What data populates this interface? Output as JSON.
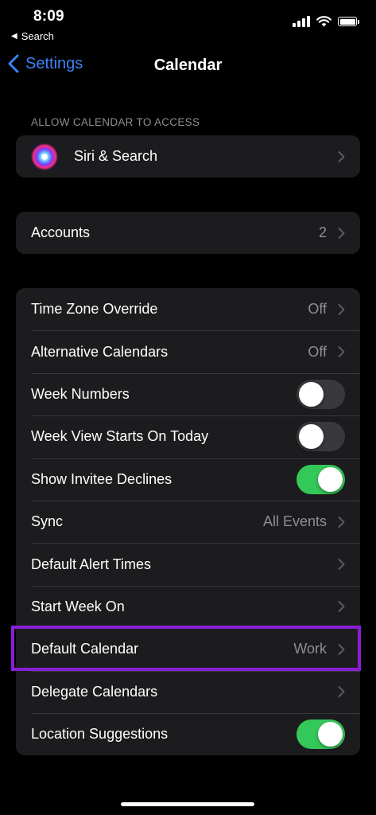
{
  "status": {
    "time": "8:09",
    "back_app": "Search"
  },
  "nav": {
    "back_label": "Settings",
    "title": "Calendar"
  },
  "section_access": {
    "header": "ALLOW CALENDAR TO ACCESS",
    "siri_label": "Siri & Search"
  },
  "accounts": {
    "label": "Accounts",
    "value": "2"
  },
  "settings": {
    "time_zone_override": {
      "label": "Time Zone Override",
      "value": "Off"
    },
    "alternative_calendars": {
      "label": "Alternative Calendars",
      "value": "Off"
    },
    "week_numbers": {
      "label": "Week Numbers",
      "on": false
    },
    "week_view_starts_on_today": {
      "label": "Week View Starts On Today",
      "on": false
    },
    "show_invitee_declines": {
      "label": "Show Invitee Declines",
      "on": true
    },
    "sync": {
      "label": "Sync",
      "value": "All Events"
    },
    "default_alert_times": {
      "label": "Default Alert Times"
    },
    "start_week_on": {
      "label": "Start Week On"
    },
    "default_calendar": {
      "label": "Default Calendar",
      "value": "Work"
    },
    "delegate_calendars": {
      "label": "Delegate Calendars"
    },
    "location_suggestions": {
      "label": "Location Suggestions",
      "on": true
    }
  },
  "colors": {
    "accent": "#3b82f6",
    "toggle_on": "#34c759",
    "highlight": "#8a1ed8"
  }
}
